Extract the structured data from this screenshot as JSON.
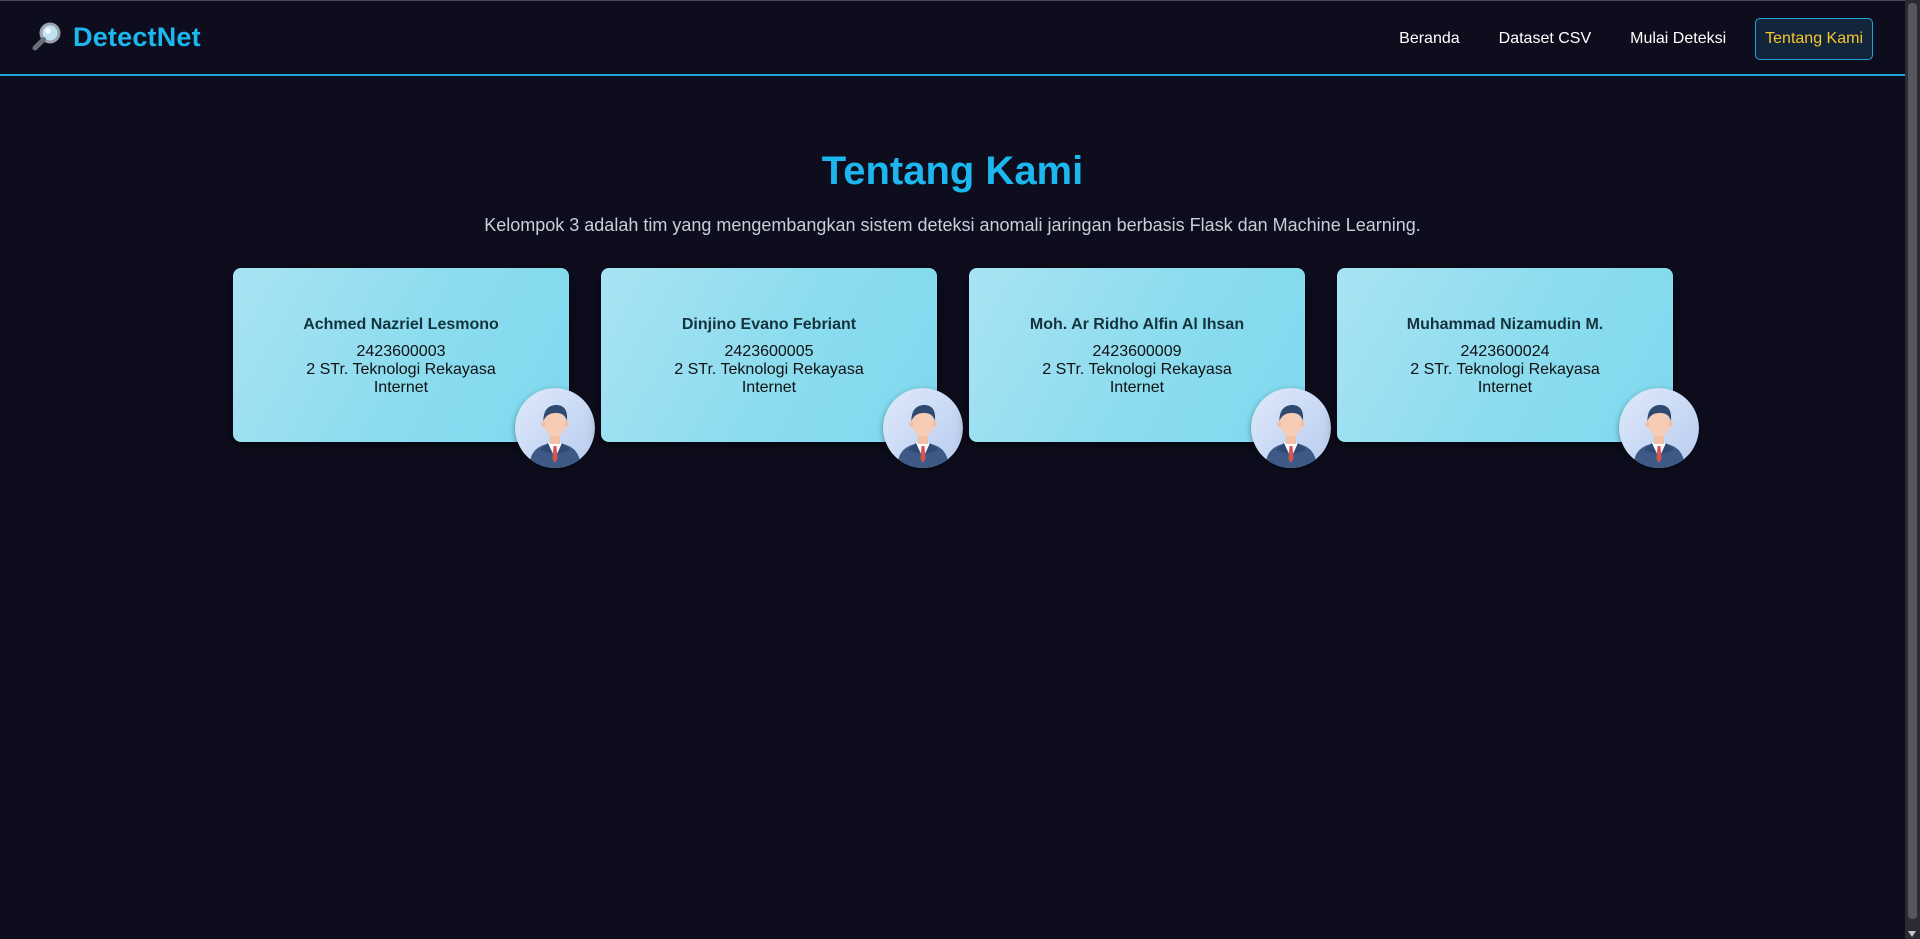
{
  "brand": {
    "icon": "magnifier-icon",
    "name": "DetectNet",
    "color": "#1db7ef"
  },
  "nav": {
    "items": [
      {
        "label": "Beranda",
        "active": false
      },
      {
        "label": "Dataset CSV",
        "active": false
      },
      {
        "label": "Mulai Deteksi",
        "active": false
      },
      {
        "label": "Tentang Kami",
        "active": true
      }
    ],
    "active_color": "#f7c52e"
  },
  "main": {
    "title": "Tentang Kami",
    "subtitle": "Kelompok 3 adalah tim yang mengembangkan sistem deteksi anomali jaringan berbasis Flask dan Machine Learning."
  },
  "members": [
    {
      "name": "Achmed Nazriel Lesmono",
      "nim": "2423600003",
      "program": "2 STr. Teknologi Rekayasa Internet",
      "avatar": "person-avatar-icon"
    },
    {
      "name": "Dinjino Evano Febriant",
      "nim": "2423600005",
      "program": "2 STr. Teknologi Rekayasa Internet",
      "avatar": "person-avatar-icon"
    },
    {
      "name": "Moh. Ar Ridho Alfin Al Ihsan",
      "nim": "2423600009",
      "program": "2 STr. Teknologi Rekayasa Internet",
      "avatar": "person-avatar-icon"
    },
    {
      "name": "Muhammad Nizamudin M.",
      "nim": "2423600024",
      "program": "2 STr. Teknologi Rekayasa Internet",
      "avatar": "person-avatar-icon"
    }
  ],
  "colors": {
    "background": "#0d0d1d",
    "accent": "#1fa3d9",
    "card": "#8bdcef"
  }
}
